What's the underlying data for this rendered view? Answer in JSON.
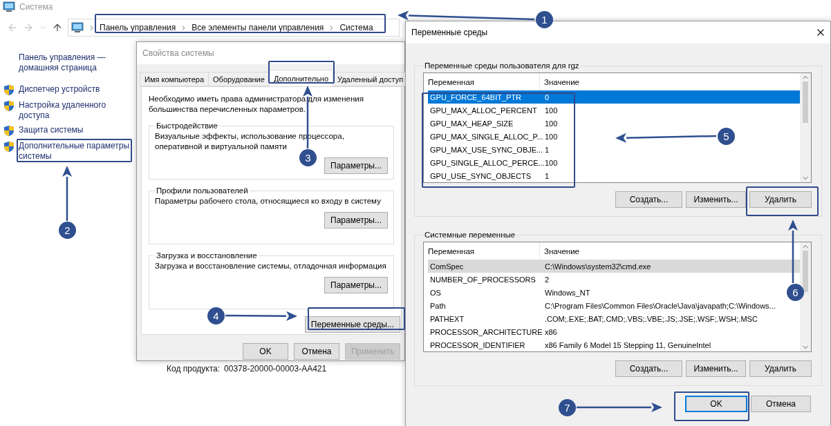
{
  "explorer": {
    "title": "Система",
    "breadcrumb": [
      "Панель управления",
      "Все элементы панели управления",
      "Система"
    ],
    "home_link": "Панель управления — домашняя страница",
    "links": [
      "Диспетчер устройств",
      "Настройка удаленного доступа",
      "Защита системы",
      "Дополнительные параметры системы"
    ],
    "product_code_label": "Код продукта:",
    "product_code": "00378-20000-00003-AA421"
  },
  "system_properties": {
    "title": "Свойства системы",
    "tabs": [
      {
        "label": "Имя компьютера",
        "selected": false
      },
      {
        "label": "Оборудование",
        "selected": false
      },
      {
        "label": "Дополнительно",
        "selected": true
      },
      {
        "label": "Удаленный доступ",
        "selected": false
      }
    ],
    "intro": "Необходимо иметь права администратора для изменения большинства перечисленных параметров.",
    "groups": [
      {
        "title": "Быстродействие",
        "text": "Визуальные эффекты, использование процессора, оперативной и виртуальной памяти",
        "button": "Параметры..."
      },
      {
        "title": "Профили пользователей",
        "text": "Параметры рабочего стола, относящиеся ко входу в систему",
        "button": "Параметры..."
      },
      {
        "title": "Загрузка и восстановление",
        "text": "Загрузка и восстановление системы, отладочная информация",
        "button": "Параметры..."
      }
    ],
    "env_button": "Переменные среды...",
    "buttons": [
      {
        "label": "OK",
        "disabled": false
      },
      {
        "label": "Отмена",
        "disabled": false
      },
      {
        "label": "Применить",
        "disabled": true
      }
    ]
  },
  "env_dialog": {
    "title": "Переменные среды",
    "sections": [
      {
        "title": "Переменные среды пользователя для rgz",
        "focused": true,
        "columns": [
          "Переменная",
          "Значение"
        ],
        "rows": [
          {
            "name": "GPU_FORCE_64BIT_PTR",
            "value": "0",
            "selected": true
          },
          {
            "name": "GPU_MAX_ALLOC_PERCENT",
            "value": "100",
            "selected": false
          },
          {
            "name": "GPU_MAX_HEAP_SIZE",
            "value": "100",
            "selected": false
          },
          {
            "name": "GPU_MAX_SINGLE_ALLOC_P...",
            "value": "100",
            "selected": false
          },
          {
            "name": "GPU_MAX_USE_SYNC_OBJE...",
            "value": "1",
            "selected": false
          },
          {
            "name": "GPU_SINGLE_ALLOC_PERCE...",
            "value": "100",
            "selected": false
          },
          {
            "name": "GPU_USE_SYNC_OBJECTS",
            "value": "1",
            "selected": false
          }
        ],
        "buttons": [
          "Создать...",
          "Изменить...",
          "Удалить"
        ]
      },
      {
        "title": "Системные переменные",
        "focused": false,
        "columns": [
          "Переменная",
          "Значение"
        ],
        "rows": [
          {
            "name": "ComSpec",
            "value": "C:\\Windows\\system32\\cmd.exe",
            "selected": true
          },
          {
            "name": "NUMBER_OF_PROCESSORS",
            "value": "2",
            "selected": false
          },
          {
            "name": "OS",
            "value": "Windows_NT",
            "selected": false
          },
          {
            "name": "Path",
            "value": "C:\\Program Files\\Common Files\\Oracle\\Java\\javapath;C:\\Windows...",
            "selected": false
          },
          {
            "name": "PATHEXT",
            "value": ".COM;.EXE;.BAT;.CMD;.VBS;.VBE;.JS;.JSE;.WSF;.WSH;.MSC",
            "selected": false
          },
          {
            "name": "PROCESSOR_ARCHITECTURE",
            "value": "x86",
            "selected": false
          },
          {
            "name": "PROCESSOR_IDENTIFIER",
            "value": "x86 Family 6 Model 15 Stepping 11, GenuineIntel",
            "selected": false
          }
        ],
        "buttons": [
          "Создать...",
          "Изменить...",
          "Удалить"
        ]
      }
    ],
    "buttons": [
      {
        "label": "OK",
        "default": true
      },
      {
        "label": "Отмена",
        "default": false
      }
    ]
  },
  "annotations": [
    {
      "label": "1"
    },
    {
      "label": "2"
    },
    {
      "label": "3"
    },
    {
      "label": "4"
    },
    {
      "label": "5"
    },
    {
      "label": "6"
    },
    {
      "label": "7"
    }
  ]
}
